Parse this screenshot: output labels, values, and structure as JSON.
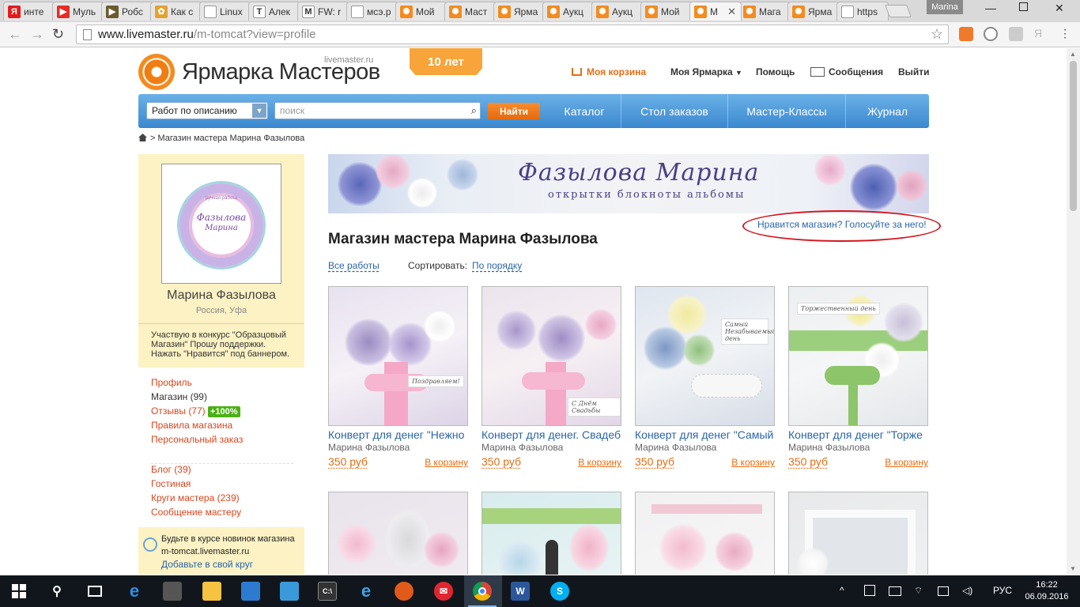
{
  "browser": {
    "tabs": [
      {
        "label": "инте",
        "icon": "yandex-icon",
        "color": "#e21d1d",
        "glyph": "Я"
      },
      {
        "label": "Муль",
        "icon": "youtube-icon",
        "color": "#e52d27",
        "glyph": "▶"
      },
      {
        "label": "Робс",
        "icon": "video-play-icon",
        "color": "#6b5b2f",
        "glyph": "▶"
      },
      {
        "label": "Как с",
        "icon": "garden-icon",
        "color": "#e2a230",
        "glyph": "✿"
      },
      {
        "label": "Linux",
        "icon": "page-icon",
        "color": "#ffffff",
        "glyph": ""
      },
      {
        "label": "Алек",
        "icon": "t-icon",
        "color": "#ffffff",
        "glyph": "T"
      },
      {
        "label": "FW: r",
        "icon": "mail-m-icon",
        "color": "#ffffff",
        "glyph": "M"
      },
      {
        "label": "мсэ.р",
        "icon": "page-icon",
        "color": "#ffffff",
        "glyph": ""
      },
      {
        "label": "Мой",
        "icon": "livemaster-icon",
        "color": "#f28c20",
        "glyph": "✺"
      },
      {
        "label": "Маст",
        "icon": "livemaster-icon",
        "color": "#f28c20",
        "glyph": "✺"
      },
      {
        "label": "Ярма",
        "icon": "livemaster-icon",
        "color": "#f28c20",
        "glyph": "✺"
      },
      {
        "label": "Аукц",
        "icon": "livemaster-icon",
        "color": "#f28c20",
        "glyph": "✺"
      },
      {
        "label": "Аукц",
        "icon": "livemaster-icon",
        "color": "#f28c20",
        "glyph": "✺"
      },
      {
        "label": "Мой",
        "icon": "livemaster-icon",
        "color": "#f28c20",
        "glyph": "✺"
      },
      {
        "label": "М",
        "icon": "livemaster-icon",
        "color": "#f28c20",
        "glyph": "✺",
        "active": true
      },
      {
        "label": "Мага",
        "icon": "livemaster-icon",
        "color": "#f28c20",
        "glyph": "✺"
      },
      {
        "label": "Ярма",
        "icon": "livemaster-icon",
        "color": "#f28c20",
        "glyph": "✺"
      },
      {
        "label": "https",
        "icon": "page-icon",
        "color": "#ffffff",
        "glyph": ""
      }
    ],
    "profile_name": "Marina",
    "url_host": "www.livemaster.ru",
    "url_path": "/m-tomcat?view=profile"
  },
  "header": {
    "logo_text": "Ярмарка Мастеров",
    "logo_sub": "livemaster.ru",
    "anniversary": "10 лет",
    "cart": "Моя корзина",
    "my_fair": "Моя Ярмарка",
    "help": "Помощь",
    "messages": "Сообщения",
    "logout": "Выйти"
  },
  "search": {
    "type_selected": "Работ по описанию",
    "placeholder": "поиск",
    "find_button": "Найти",
    "nav": [
      "Каталог",
      "Стол заказов",
      "Мастер-Классы",
      "Журнал"
    ]
  },
  "breadcrumb": "> Магазин мастера Марина Фазылова",
  "sidebar": {
    "avatar_small": "ручная работа",
    "avatar_line1": "Фазылова",
    "avatar_line2": "Марина",
    "name": "Марина Фазылова",
    "location": "Россия, Уфа",
    "note": "Участвую в конкурс \"Образцовый Магазин\" Прошу поддержки. Нажать \"Нравится\" под баннером.",
    "links1": {
      "profile": "Профиль",
      "shop": "Магазин",
      "shop_count": "(99)",
      "reviews": "Отзывы",
      "reviews_count": "(77)",
      "reviews_badge": "+100%",
      "rules": "Правила магазина",
      "custom_order": "Персональный заказ"
    },
    "links2": {
      "blog": "Блог",
      "blog_count": "(39)",
      "guestroom": "Гостиная",
      "circles": "Круги мастера",
      "circles_count": "(239)",
      "message": "Сообщение мастеру"
    },
    "subscribe": {
      "line1": "Будьте в курсе новинок магазина",
      "line2": "m-tomcat.livemaster.ru",
      "link": "Добавьте в свой круг"
    }
  },
  "banner": {
    "title": "Фазылова Марина",
    "subtitle": "открытки блокноты альбомы"
  },
  "vote_link": "Нравится магазин? Голосуйте за него!",
  "page_title": "Магазин мастера Марина Фазылова",
  "filters": {
    "all": "Все работы",
    "sort_label": "Сортировать:",
    "sort_value": "По порядку"
  },
  "products": [
    {
      "title": "Конверт для денег \"Нежно",
      "author": "Марина Фазылова",
      "price": "350 руб",
      "buy": "В корзину",
      "tag": "Поздравляем!"
    },
    {
      "title": "Конверт для денег. Свадеб",
      "author": "Марина Фазылова",
      "price": "350 руб",
      "buy": "В корзину",
      "tag": "С Днём Свадьбы"
    },
    {
      "title": "Конверт для денег \"Самый",
      "author": "Марина Фазылова",
      "price": "350 руб",
      "buy": "В корзину",
      "tag": "Самый Незабываемый день"
    },
    {
      "title": "Конверт для денег \"Торже",
      "author": "Марина Фазылова",
      "price": "350 руб",
      "buy": "В корзину",
      "tag": "Торжественный день"
    }
  ],
  "taskbar": {
    "language": "РУС",
    "time": "16:22",
    "date": "06.09.2016"
  }
}
